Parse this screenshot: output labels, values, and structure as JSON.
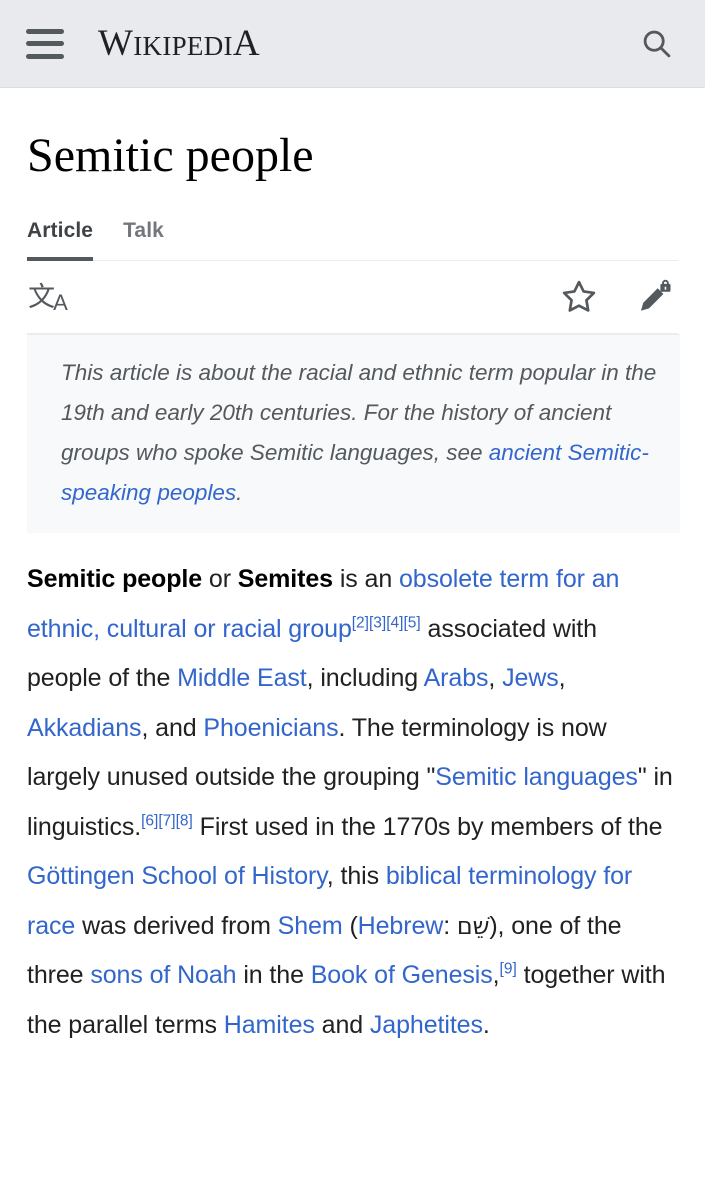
{
  "header": {
    "menu_icon": "hamburger-menu-icon",
    "wordmark_full": "WIKIPEDIA",
    "wordmark_first": "W",
    "wordmark_mid": "IKIPEDI",
    "wordmark_last": "A",
    "search_icon": "search-icon",
    "background_color": "#e9eaee"
  },
  "article": {
    "title": "Semitic people"
  },
  "tabs": [
    {
      "label": "Article",
      "active": true
    },
    {
      "label": "Talk",
      "active": false
    }
  ],
  "actions": {
    "language_icon": "language-icon",
    "language_glyph_cjk": "文",
    "language_glyph_latin": "A",
    "watch_icon": "star-icon",
    "edit_icon": "pencil-lock-icon"
  },
  "hatnote": {
    "text_before": "This article is about the racial and ethnic term popular in the 19th and early 20th centuries. For the history of ancient groups who spoke Semitic languages, see ",
    "link": "ancient Semitic-speaking peoples",
    "text_after": "."
  },
  "lead": {
    "bold_term_1": "Semitic people",
    "t1": " or ",
    "bold_term_2": "Semites",
    "t2": " is an ",
    "link_1": "obsolete term for an ethnic, cultural or racial group",
    "ref_2": "[2]",
    "ref_3": "[3]",
    "ref_4": "[4]",
    "ref_5": "[5]",
    "t3": " associated with people of the ",
    "link_2": "Middle East",
    "t4": ", including ",
    "link_3": "Arabs",
    "t5": ", ",
    "link_4": "Jews",
    "t6": ", ",
    "link_5": "Akkadians",
    "t7": ", and ",
    "link_6": "Phoenicians",
    "t8": ". The terminology is now largely unused outside the grouping \"",
    "link_7": "Semitic languages",
    "t9": "\" in linguistics.",
    "ref_6": "[6]",
    "ref_7": "[7]",
    "ref_8": "[8]",
    "t10": " First used in the 1770s by members of the ",
    "link_8": "Göttingen School of History",
    "t11": ", this ",
    "link_9": "biblical terminology for race",
    "t12": " was derived from ",
    "link_10": "Shem",
    "t13": " (",
    "link_11": "Hebrew",
    "t14": ": ",
    "hebrew_word": "שֵׁם",
    "t15": "), one of the three ",
    "link_12": "sons of Noah",
    "t16": " in the ",
    "link_13": "Book of Genesis",
    "t17": ",",
    "ref_9": "[9]",
    "t18": " together with the parallel terms ",
    "link_14": "Hamites",
    "t19": " and ",
    "link_15": "Japhetites",
    "t20": "."
  },
  "colors": {
    "link": "#3366cc",
    "text": "#202122",
    "muted": "#54595d",
    "hatnote_bg": "#f8f9fa"
  }
}
